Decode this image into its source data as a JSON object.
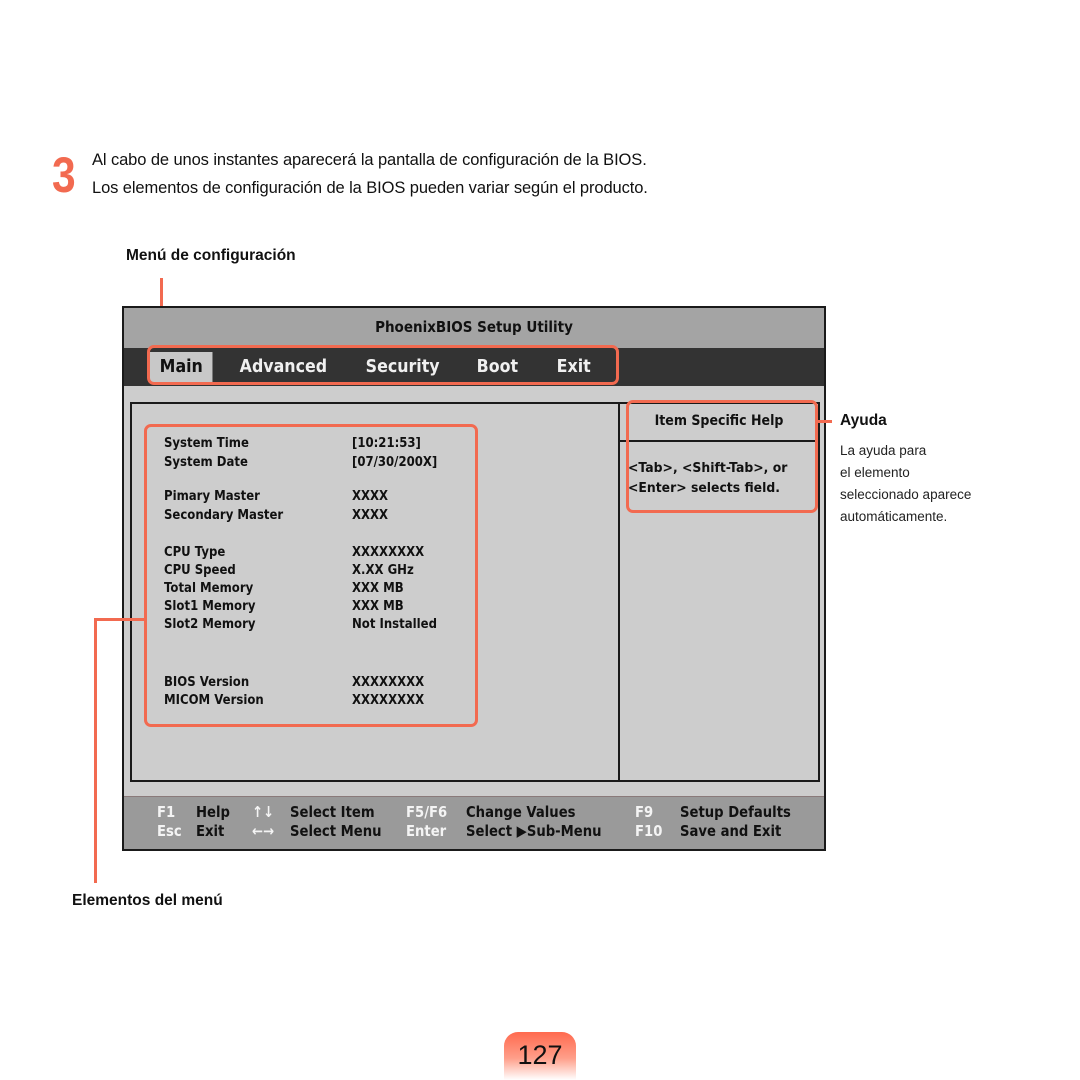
{
  "step": {
    "number": "3",
    "lines": [
      "Al cabo de unos instantes aparecerá la pantalla de configuración de la BIOS.",
      "Los elementos de configuración de la BIOS pueden variar según el producto."
    ]
  },
  "callouts": {
    "menu_config": "Menú de configuración",
    "menu_items": "Elementos del menú",
    "help_title": "Ayuda",
    "help_desc": [
      "La ayuda para",
      "el elemento",
      "seleccionado aparece",
      "automáticamente."
    ]
  },
  "bios": {
    "title": "PhoenixBIOS Setup Utility",
    "tabs": [
      {
        "label": "Main",
        "active": true
      },
      {
        "label": "Advanced",
        "active": false
      },
      {
        "label": "Security",
        "active": false
      },
      {
        "label": "Boot",
        "active": false
      },
      {
        "label": "Exit",
        "active": false
      }
    ],
    "rows": [
      {
        "label": "System Time",
        "value": "[10:21:53]"
      },
      {
        "label": "System Date",
        "value": "[07/30/200X]"
      },
      {
        "label": "Pimary Master",
        "value": "XXXX"
      },
      {
        "label": "Secondary Master",
        "value": "XXXX"
      },
      {
        "label": "CPU Type",
        "value": "XXXXXXXX"
      },
      {
        "label": "CPU Speed",
        "value": "X.XX GHz"
      },
      {
        "label": "Total Memory",
        "value": "XXX MB"
      },
      {
        "label": "Slot1 Memory",
        "value": "XXX MB"
      },
      {
        "label": "Slot2 Memory",
        "value": "Not Installed"
      },
      {
        "label": "BIOS Version",
        "value": "XXXXXXXX"
      },
      {
        "label": "MICOM Version",
        "value": "XXXXXXXX"
      }
    ],
    "help": {
      "title": "Item Specific Help",
      "lines": [
        "<Tab>, <Shift-Tab>, or",
        "<Enter> selects field."
      ]
    },
    "footer": [
      {
        "key": "F1",
        "desc": "Help"
      },
      {
        "key": "↑↓",
        "desc": "Select Item"
      },
      {
        "key": "F5/F6",
        "desc": "Change Values"
      },
      {
        "key": "F9",
        "desc": "Setup Defaults"
      },
      {
        "key": "Esc",
        "desc": "Exit"
      },
      {
        "key": "←→",
        "desc": "Select Menu"
      },
      {
        "key": "Enter",
        "desc": "Select ▶Sub-Menu"
      },
      {
        "key": "F10",
        "desc": "Save and Exit"
      }
    ]
  },
  "page": {
    "number": "127"
  },
  "colors": {
    "accent": "#f26a50",
    "menubar": "#333333",
    "screen": "#cdcdcd",
    "footer": "#9a9a9a"
  }
}
